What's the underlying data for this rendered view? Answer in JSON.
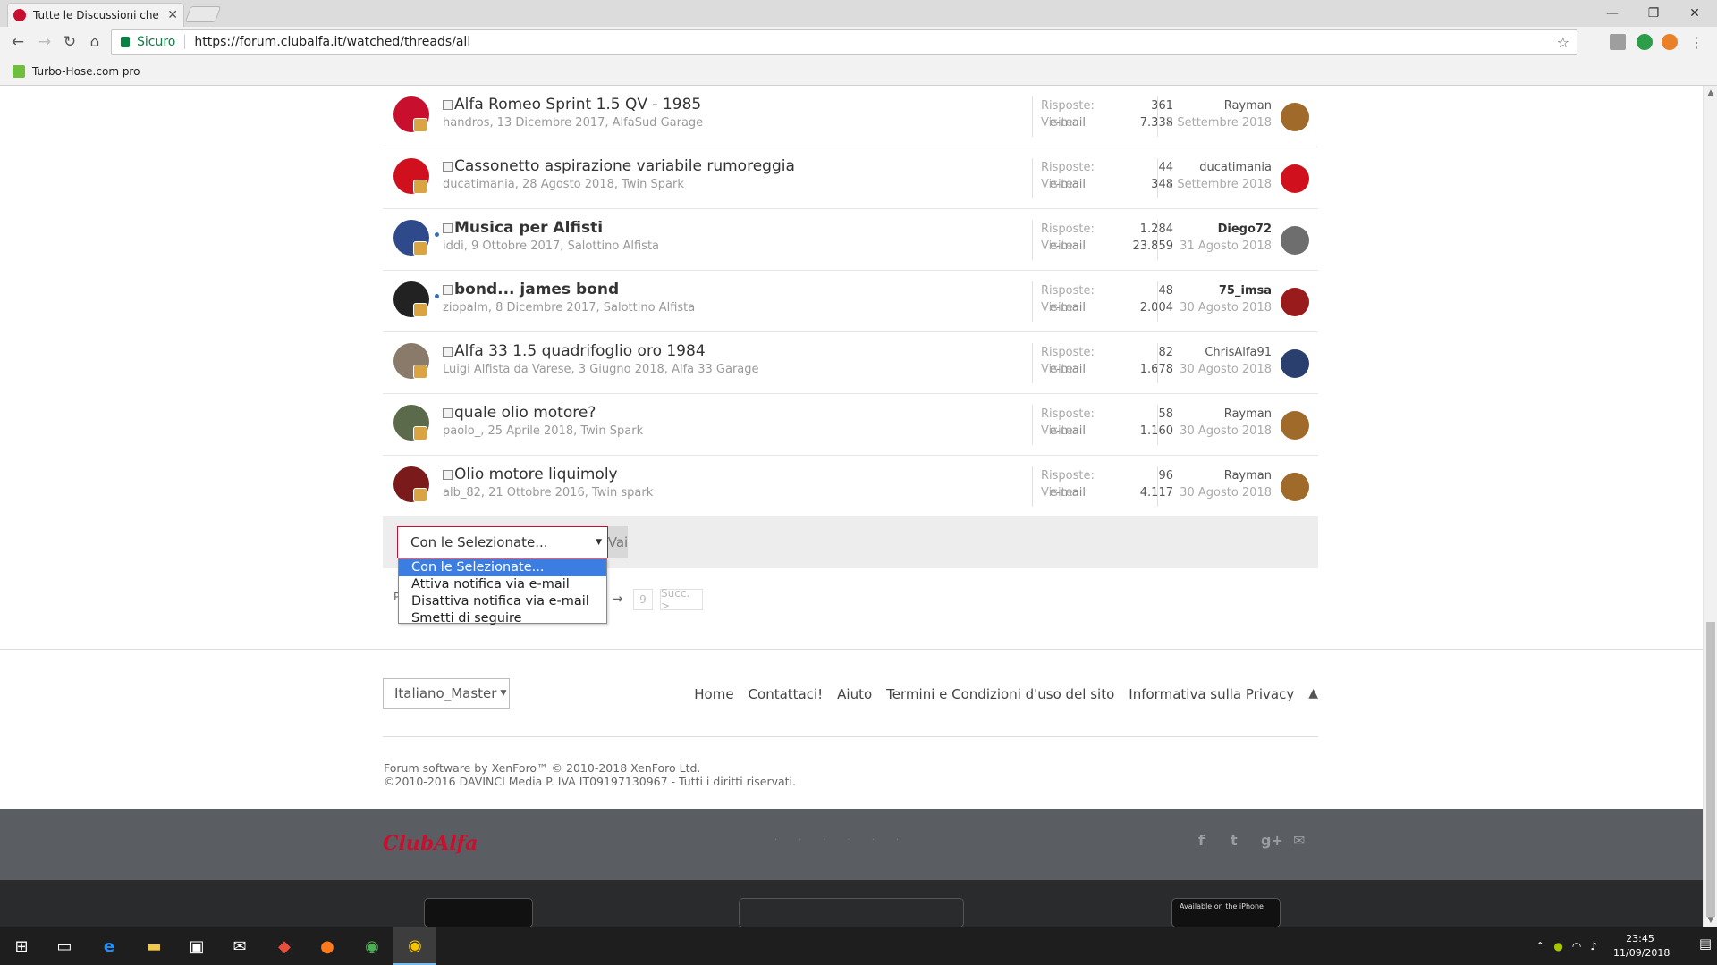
{
  "browser": {
    "tab_title": "Tutte le Discussioni che s",
    "tab_close": "✕",
    "secure_label": "Sicuro",
    "url": "https://forum.clubalfa.it/watched/threads/all",
    "bookmark": "Turbo-Hose.com pro",
    "icons": {
      "back": "back-arrow-icon",
      "forward": "forward-arrow-icon",
      "reload": "reload-icon",
      "home": "home-icon",
      "star": "bookmark-star-icon",
      "menu": "chrome-menu-icon"
    }
  },
  "threads": [
    {
      "title": "Alfa Romeo Sprint 1.5 QV - 1985",
      "bold": false,
      "unread": false,
      "meta": "handros, 13 Dicembre 2017, AlfaSud Garage",
      "email": "e-mail",
      "replies_label": "Risposte:",
      "replies": "361",
      "views_label": "Visite:",
      "views": "7.338",
      "last_user": "Rayman",
      "last_date": "2 Settembre 2018",
      "avatar_color": "#c8102e",
      "last_avatar_color": "#a06a2a"
    },
    {
      "title": "Cassonetto aspirazione variabile rumoreggia",
      "bold": false,
      "unread": false,
      "meta": "ducatimania, 28 Agosto 2018, Twin Spark",
      "email": "e-mail",
      "replies_label": "Risposte:",
      "replies": "44",
      "views_label": "Visite:",
      "views": "348",
      "last_user": "ducatimania",
      "last_date": "1 Settembre 2018",
      "avatar_color": "#d0101c",
      "last_avatar_color": "#d0101c"
    },
    {
      "title": "Musica per Alfisti",
      "bold": true,
      "unread": true,
      "meta": "iddi, 9 Ottobre 2017, Salottino Alfista",
      "email": "e-mail",
      "replies_label": "Risposte:",
      "replies": "1.284",
      "views_label": "Visite:",
      "views": "23.859",
      "last_user": "Diego72",
      "last_date": "31 Agosto 2018",
      "avatar_color": "#2f4a8a",
      "last_avatar_color": "#6e6e6e"
    },
    {
      "title": "bond... james bond",
      "bold": true,
      "unread": true,
      "meta": "ziopalm, 8 Dicembre 2017, Salottino Alfista",
      "email": "e-mail",
      "replies_label": "Risposte:",
      "replies": "48",
      "views_label": "Visite:",
      "views": "2.004",
      "last_user": "75_imsa",
      "last_date": "30 Agosto 2018",
      "avatar_color": "#222222",
      "last_avatar_color": "#9a1b1b"
    },
    {
      "title": "Alfa 33 1.5 quadrifoglio oro 1984",
      "bold": false,
      "unread": false,
      "meta": "Luigi Alfista da Varese, 3 Giugno 2018, Alfa 33 Garage",
      "email": "e-mail",
      "replies_label": "Risposte:",
      "replies": "82",
      "views_label": "Visite:",
      "views": "1.678",
      "last_user": "ChrisAlfa91",
      "last_date": "30 Agosto 2018",
      "avatar_color": "#8a7a6a",
      "last_avatar_color": "#2a3f6e"
    },
    {
      "title": "quale olio motore?",
      "bold": false,
      "unread": false,
      "meta": "paolo_, 25 Aprile 2018, Twin Spark",
      "email": "e-mail",
      "replies_label": "Risposte:",
      "replies": "58",
      "views_label": "Visite:",
      "views": "1.160",
      "last_user": "Rayman",
      "last_date": "30 Agosto 2018",
      "avatar_color": "#5a6a4a",
      "last_avatar_color": "#a06a2a"
    },
    {
      "title": "Olio motore liquimoly",
      "bold": false,
      "unread": false,
      "meta": "alb_82, 21 Ottobre 2016, Twin spark",
      "email": "e-mail",
      "replies_label": "Risposte:",
      "replies": "96",
      "views_label": "Visite:",
      "views": "4.117",
      "last_user": "Rayman",
      "last_date": "30 Agosto 2018",
      "avatar_color": "#7a1a1a",
      "last_avatar_color": "#a06a2a"
    }
  ],
  "actions": {
    "selected": "Con le Selezionate...",
    "go": "Vai",
    "options": [
      "Con le Selezionate...",
      "Attiva notifica via e-mail",
      "Disattiva notifica via e-mail",
      "Smetti di seguire"
    ]
  },
  "pagination": {
    "prefix": "P",
    "arrow": "→",
    "last_page": "9",
    "next": "Succ. >"
  },
  "footer": {
    "language": "Italiano_Master",
    "links": [
      "Home",
      "Contattaci!",
      "Aiuto",
      "Termini e Condizioni d'uso del sito",
      "Informativa sulla Privacy"
    ],
    "copyright_1": "Forum software by XenForo™ © 2010-2018 XenForo Ltd.",
    "copyright_2": "©2010-2016 DAVINCI Media P. IVA IT09197130967 - Tutti i diritti riservati.",
    "logo": "ClubAlfa",
    "social": [
      "f",
      "t",
      "g+",
      "✉"
    ],
    "app_badge": "Available on the iPhone"
  },
  "taskbar": {
    "time": "23:45",
    "date": "11/09/2018"
  }
}
